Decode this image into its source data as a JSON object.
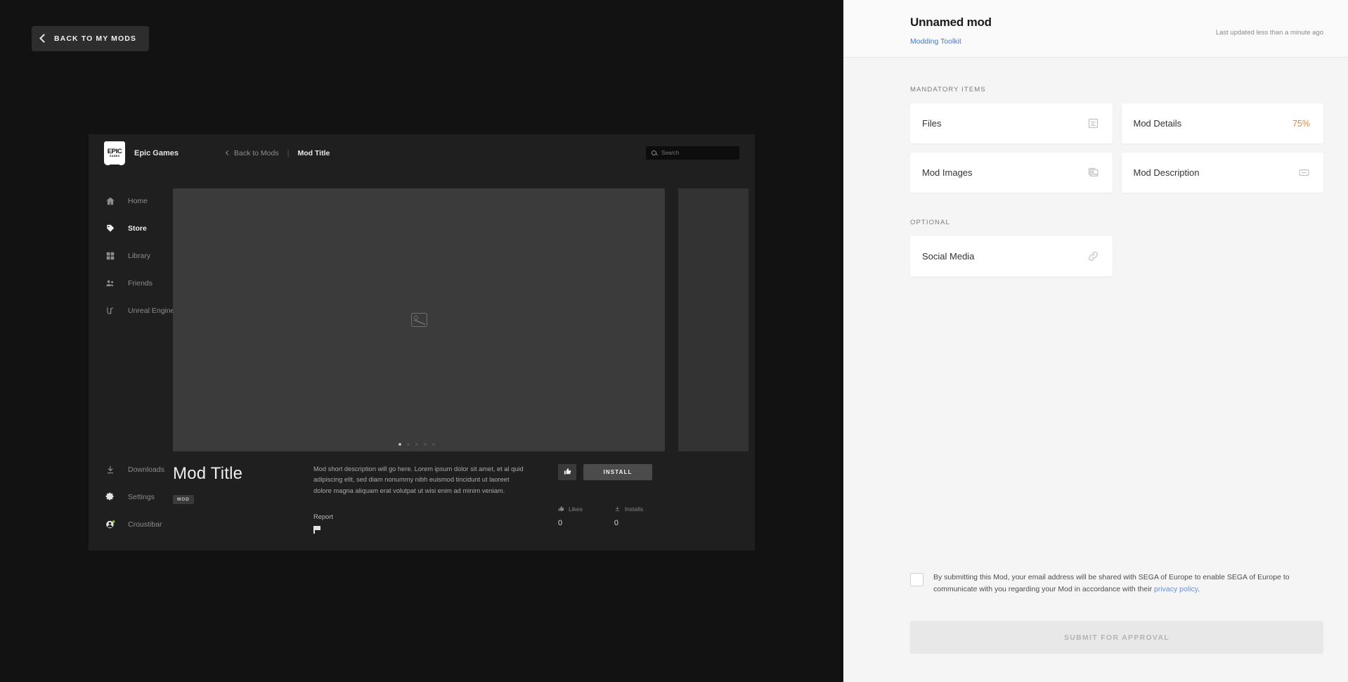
{
  "launcher_overlay": {
    "back_button": "BACK TO MY MODS",
    "brand": "Epic Games",
    "breadcrumb_back": "Back to Mods",
    "breadcrumb_current": "Mod Title",
    "search_placeholder": "Search",
    "nav": [
      {
        "label": "Home",
        "icon": "home-icon",
        "active": false
      },
      {
        "label": "Store",
        "icon": "tag-icon",
        "active": true
      },
      {
        "label": "Library",
        "icon": "grid-icon",
        "active": false
      },
      {
        "label": "Friends",
        "icon": "people-icon",
        "active": false
      },
      {
        "label": "Unreal Engine",
        "icon": "unreal-icon",
        "active": false
      }
    ],
    "nav_bottom": [
      {
        "label": "Downloads",
        "icon": "download-icon"
      },
      {
        "label": "Settings",
        "icon": "gear-icon"
      },
      {
        "label": "Croustibar",
        "icon": "account-icon"
      }
    ],
    "carousel": {
      "dots": 5,
      "active_dot": 0,
      "placeholder_icon": "image-placeholder-icon"
    },
    "mod": {
      "title": "Mod Title",
      "badge": "MOD",
      "description": "Mod short description will go here. Lorem ipsum dolor sit amet, et al quid adipiscing elit, sed diam nonummy nibh euismod tincidunt ut laoreet dolore magna aliquam erat volutpat ut wisi enim ad minim veniam.",
      "report_label": "Report",
      "install_label": "INSTALL",
      "like_icon": "thumbs-up-icon",
      "stats": [
        {
          "label": "Likes",
          "value": "0",
          "icon": "thumbs-up-icon"
        },
        {
          "label": "Installs",
          "value": "0",
          "icon": "download-icon"
        }
      ]
    }
  },
  "panel": {
    "title": "Unnamed mod",
    "subtitle_link": "Modding Toolkit",
    "last_updated": "Last updated less than a minute ago",
    "mandatory_label": "MANDATORY ITEMS",
    "optional_label": "OPTIONAL",
    "mandatory_items": [
      {
        "name": "Files",
        "icon": "document-icon",
        "progress": ""
      },
      {
        "name": "Mod Details",
        "icon": "",
        "progress": "75%"
      },
      {
        "name": "Mod Images",
        "icon": "image-icon",
        "progress": ""
      },
      {
        "name": "Mod Description",
        "icon": "text-box-icon",
        "progress": ""
      }
    ],
    "optional_items": [
      {
        "name": "Social Media",
        "icon": "link-icon"
      }
    ],
    "consent_text_before": "By submitting this Mod, your email address will be shared with SEGA of Europe to enable SEGA of Europe to communicate with you regarding your Mod in accordance with their ",
    "consent_link": "privacy policy",
    "consent_text_after": ".",
    "submit_label": "SUBMIT FOR APPROVAL",
    "accent_color": "#e2883f",
    "link_color": "#4a78c8"
  }
}
